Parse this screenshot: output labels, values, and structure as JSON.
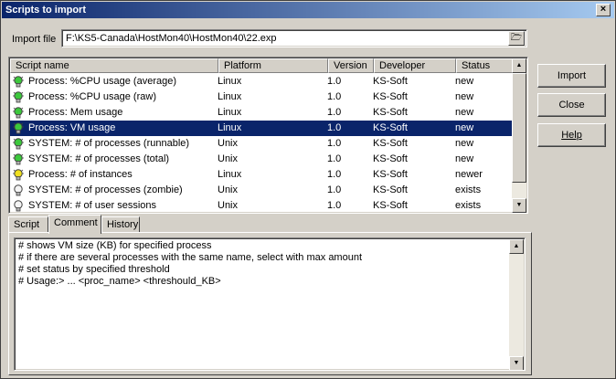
{
  "window": {
    "title": "Scripts to import",
    "close_glyph": "×"
  },
  "import_file": {
    "label": "Import file",
    "value": "F:\\KS5-Canada\\HostMon40\\HostMon40\\22.exp",
    "browse_glyph": "🗁"
  },
  "table": {
    "columns": [
      "Script name",
      "Platform",
      "Version",
      "Developer",
      "Status"
    ],
    "rows": [
      {
        "name": "Process: %CPU usage (average)",
        "platform": "Linux",
        "version": "1.0",
        "developer": "KS-Soft",
        "status": "new",
        "icon": "bulb-green-icon"
      },
      {
        "name": "Process: %CPU usage (raw)",
        "platform": "Linux",
        "version": "1.0",
        "developer": "KS-Soft",
        "status": "new",
        "icon": "bulb-green-icon"
      },
      {
        "name": "Process: Mem usage",
        "platform": "Linux",
        "version": "1.0",
        "developer": "KS-Soft",
        "status": "new",
        "icon": "bulb-green-icon"
      },
      {
        "name": "Process: VM usage",
        "platform": "Linux",
        "version": "1.0",
        "developer": "KS-Soft",
        "status": "new",
        "icon": "bulb-green-icon",
        "selected": true
      },
      {
        "name": "SYSTEM: # of processes (runnable)",
        "platform": "Unix",
        "version": "1.0",
        "developer": "KS-Soft",
        "status": "new",
        "icon": "bulb-green-icon"
      },
      {
        "name": "SYSTEM: # of processes (total)",
        "platform": "Unix",
        "version": "1.0",
        "developer": "KS-Soft",
        "status": "new",
        "icon": "bulb-green-icon"
      },
      {
        "name": "Process: # of instances",
        "platform": "Linux",
        "version": "1.0",
        "developer": "KS-Soft",
        "status": "newer",
        "icon": "bulb-yellow-icon"
      },
      {
        "name": "SYSTEM: # of processes (zombie)",
        "platform": "Unix",
        "version": "1.0",
        "developer": "KS-Soft",
        "status": "exists",
        "icon": "bulb-off-icon"
      },
      {
        "name": "SYSTEM: # of user sessions",
        "platform": "Unix",
        "version": "1.0",
        "developer": "KS-Soft",
        "status": "exists",
        "icon": "bulb-off-icon"
      }
    ]
  },
  "tabs": [
    {
      "label": "Script",
      "active": false
    },
    {
      "label": "Comment",
      "active": true
    },
    {
      "label": "History",
      "active": false
    }
  ],
  "comment_lines": [
    "# shows VM size (KB) for specified process",
    "# if there are several processes with the same name, select with max amount",
    "# set status by specified threshold",
    "# Usage:> ...  <proc_name>  <threshould_KB>"
  ],
  "buttons": {
    "import": "Import",
    "close": "Close",
    "help": "Help"
  },
  "colors": {
    "title_start": "#0a246a",
    "title_end": "#a6caf0",
    "selection": "#0a246a",
    "bulb_green": "#3cc83c",
    "bulb_yellow": "#f0e020",
    "bulb_off": "#f4f4f4"
  }
}
